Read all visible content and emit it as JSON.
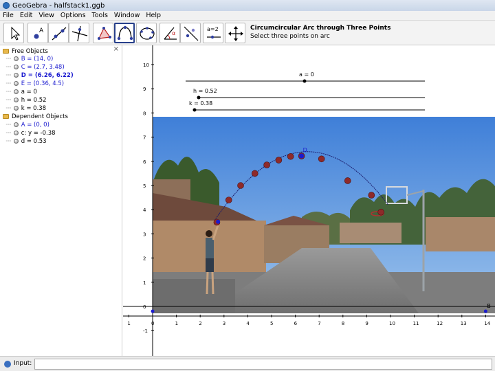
{
  "window": {
    "title": "GeoGebra - halfstack1.ggb"
  },
  "menu": [
    "File",
    "Edit",
    "View",
    "Options",
    "Tools",
    "Window",
    "Help"
  ],
  "toolbar": {
    "tools": [
      {
        "name": "move-tool",
        "icon": "arrow-pointer-icon"
      },
      {
        "name": "point-tool",
        "icon": "point-a-icon"
      },
      {
        "name": "line-tool",
        "icon": "line-two-points-icon"
      },
      {
        "name": "perpendicular-tool",
        "icon": "perpendicular-line-icon"
      },
      {
        "name": "polygon-tool",
        "icon": "triangle-polygon-icon"
      },
      {
        "name": "circumcircular-arc-tool",
        "icon": "arc-three-points-icon",
        "selected": true
      },
      {
        "name": "conic-tool",
        "icon": "ellipse-five-points-icon"
      },
      {
        "name": "angle-tool",
        "icon": "angle-alpha-icon"
      },
      {
        "name": "reflect-tool",
        "icon": "reflect-line-icon"
      },
      {
        "name": "slider-tool",
        "icon": "slider-a2-icon",
        "label": "a=2"
      },
      {
        "name": "move-view-tool",
        "icon": "move-graphics-view-icon"
      }
    ],
    "help_title": "Circumcircular Arc through Three Points",
    "help_desc": "Select three points on arc"
  },
  "algebra": {
    "free_header": "Free Objects",
    "free": [
      {
        "text": "B = (14, 0)",
        "style": "free"
      },
      {
        "text": "C = (2.7, 3.48)",
        "style": "free"
      },
      {
        "text": "D = (6.26, 6.22)",
        "style": "sel"
      },
      {
        "text": "E = (0.36, 4.5)",
        "style": "free"
      },
      {
        "text": "a = 0",
        "style": "plain"
      },
      {
        "text": "h = 0.52",
        "style": "plain"
      },
      {
        "text": "k = 0.38",
        "style": "plain"
      }
    ],
    "dependent_header": "Dependent Objects",
    "dependent": [
      {
        "text": "A = (0, 0)",
        "style": "free"
      },
      {
        "text": "c: y = -0.38",
        "style": "plain"
      },
      {
        "text": "d = 0.53",
        "style": "plain"
      }
    ]
  },
  "graphics": {
    "x_ticks": [
      "1",
      "0",
      "1",
      "2",
      "3",
      "4",
      "5",
      "6",
      "7",
      "8",
      "9",
      "10",
      "11",
      "12",
      "13",
      "14"
    ],
    "y_ticks": [
      "10",
      "9",
      "8",
      "7",
      "6",
      "5",
      "4",
      "3",
      "2",
      "1",
      "0",
      "-1"
    ],
    "sliders": [
      {
        "label": "a = 0"
      },
      {
        "label": "h = 0.52"
      },
      {
        "label": "k = 0.38"
      }
    ],
    "point_labels": {
      "D": "D",
      "B": "B"
    },
    "colors": {
      "sky": "#5a8fd6",
      "trees": "#3f5a2e",
      "building": "#a87c5c",
      "roof": "#7a5244",
      "road": "#8a8a8a",
      "ball": "#8e2a2a",
      "arc": "#000000",
      "selected_point": "#1a1acf"
    }
  },
  "input": {
    "label": "Input:",
    "value": ""
  }
}
